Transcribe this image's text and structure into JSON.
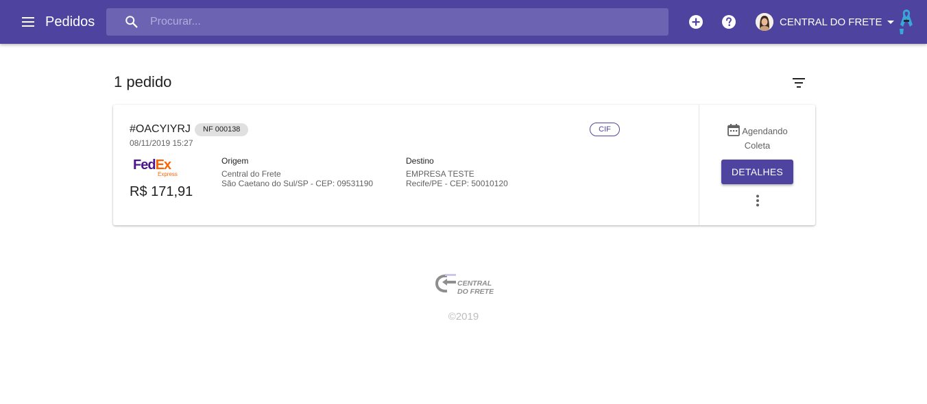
{
  "header": {
    "title": "Pedidos",
    "search_placeholder": "Procurar...",
    "user_name": "CENTRAL DO FRETE",
    "icons": {
      "menu": "menu-icon",
      "search": "search-icon",
      "add": "add-circle-icon",
      "help": "help-icon",
      "dropdown": "caret-down-icon",
      "ribbon": "awareness-ribbon-icon"
    },
    "colors": {
      "primary": "#4e44a0",
      "search_bg": "#6c63b3"
    }
  },
  "main": {
    "count_label": "1 pedido",
    "filter_icon": "filter-icon"
  },
  "orders": [
    {
      "id": "#OACYIYRJ",
      "nf": "NF 000138",
      "date": "08/11/2019 15:27",
      "freight_type": "CIF",
      "carrier": {
        "logo_text_fed": "Fed",
        "logo_text_ex": "Ex",
        "logo_sub": "Express"
      },
      "price": "R$ 171,91",
      "origin": {
        "label": "Origem",
        "name": "Central do Frete",
        "address": "São Caetano do Sul/SP - CEP: 09531190"
      },
      "destination": {
        "label": "Destino",
        "name": "EMPRESA TESTE",
        "address": "Recife/PE - CEP: 50010120"
      },
      "status_line1": "Agendando",
      "status_line2": "Coleta",
      "details_label": "DETALHES"
    }
  ],
  "footer": {
    "logo_line1": "CENTRAL",
    "logo_line2": "DO FRETE",
    "copyright": "©2019"
  }
}
